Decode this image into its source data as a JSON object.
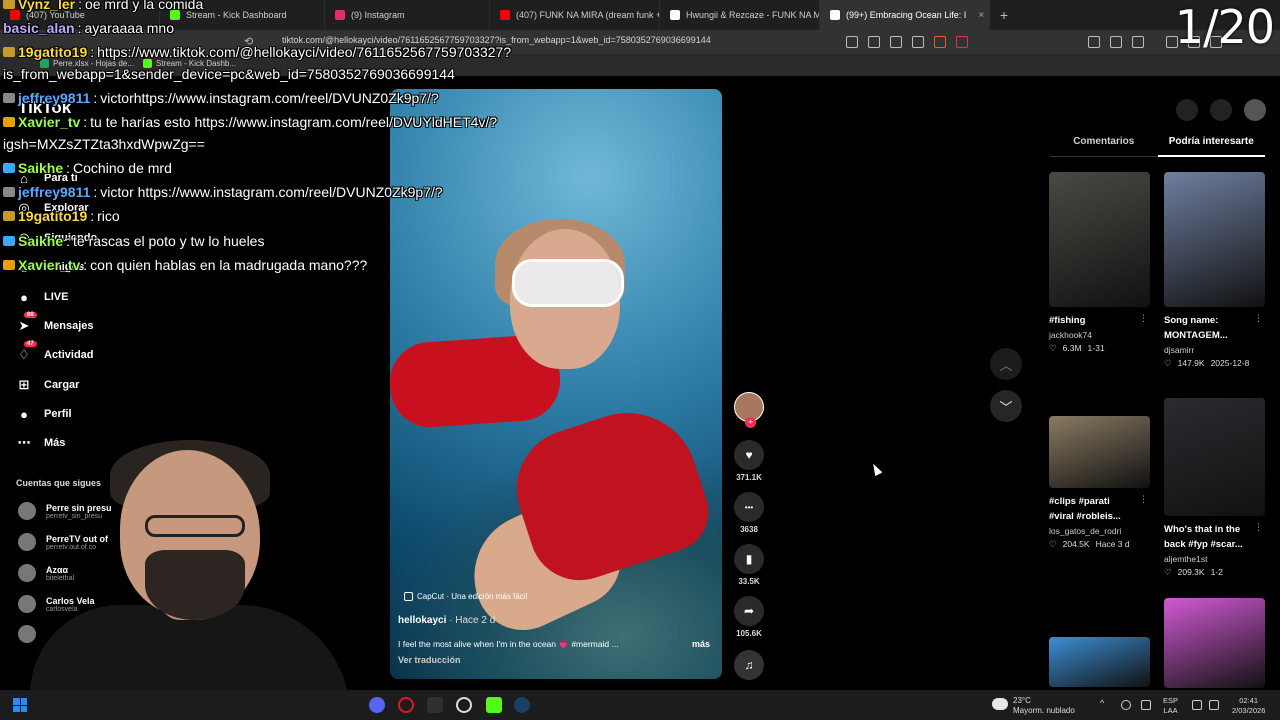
{
  "browser": {
    "tabs": [
      {
        "label": "(407) YouTube",
        "color": "#ff0000"
      },
      {
        "label": "Stream - Kick Dashboard",
        "color": "#53fc18"
      },
      {
        "label": "(9) Instagram",
        "color": "#e1306c"
      },
      {
        "label": "(407) FUNK NA MIRA (dream funk +",
        "color": "#ff0000"
      },
      {
        "label": "Hwungii & Rezcaze - FUNK NA MIRA",
        "color": "#ffffff"
      },
      {
        "label": "(99+) Embracing Ocean Life: I",
        "color": "#ffffff",
        "active": true
      }
    ],
    "new_tab": "+",
    "url": "tiktok.com/@hellokayci/video/7611652567759703327?is_from_webapp=1&web_id=7580352769036699144",
    "bookmarks": [
      {
        "label": "Perre.xlsx - Hojas de...",
        "color": "#1fa463"
      },
      {
        "label": "Stream - Kick Dashb...",
        "color": "#53fc18"
      }
    ]
  },
  "overlay_counter": "1/20",
  "chat": [
    {
      "user": "Vynz_ler",
      "text": " oe mrd y la comida",
      "color": "#ffd84a",
      "badge": "#c79a2b"
    },
    {
      "user": "basic_alan",
      "text": " ayaraaaa mno",
      "color": "#c0a6ff",
      "badge": ""
    },
    {
      "user": "19gatito19",
      "text": " https://www.tiktok.com/@hellokayci/video/7611652567759703327?",
      "color": "#ffd84a",
      "badge": "#c79a2b"
    },
    {
      "user": "",
      "text": "is_from_webapp=1&sender_device=pc&web_id=7580352769036699144",
      "color": "#ffffff",
      "badge": ""
    },
    {
      "user": "jeffrey9811",
      "text": " victorhttps://www.instagram.com/reel/DVUNZ0Zk9p7/?",
      "color": "#5aa9ff",
      "badge": "#888888"
    },
    {
      "user": "Xavier_tv",
      "text": " tu te harías esto https://www.instagram.com/reel/DVUYldHET4v/?",
      "color": "#9dff4a",
      "badge": "#e5a100"
    },
    {
      "user": "",
      "text": "igsh=MXZsZTZta3hxdWpwZg==",
      "color": "#ffffff",
      "badge": ""
    },
    {
      "user": "Saikhe",
      "text": " Cochino de mrd",
      "color": "#9dff4a",
      "badge": "#3aa8ff"
    },
    {
      "user": "jeffrey9811",
      "text": " victor https://www.instagram.com/reel/DVUNZ0Zk9p7/?",
      "color": "#5aa9ff",
      "badge": "#888888"
    },
    {
      "user": "19gatito19",
      "text": " rico",
      "color": "#ffd84a",
      "badge": "#c79a2b"
    },
    {
      "user": "Saikhe",
      "text": " te rascas el poto y tw lo hueles",
      "color": "#9dff4a",
      "badge": "#3aa8ff"
    },
    {
      "user": "Xavier_tv",
      "text": " con quien hablas en la madrugada mano???",
      "color": "#9dff4a",
      "badge": "#e5a100"
    }
  ],
  "tiktok": {
    "logo": "TikTok",
    "nav": [
      {
        "label": "Para ti",
        "icon": "home-icon"
      },
      {
        "label": "Explorar",
        "icon": "compass-icon"
      },
      {
        "label": "Siguiendo",
        "icon": "following-icon"
      },
      {
        "label": "Amigos",
        "icon": "friends-icon"
      },
      {
        "label": "LIVE",
        "icon": "live-icon"
      },
      {
        "label": "Mensajes",
        "icon": "messages-icon",
        "badge": "88"
      },
      {
        "label": "Actividad",
        "icon": "activity-icon",
        "badge": "47"
      },
      {
        "label": "Cargar",
        "icon": "upload-icon"
      },
      {
        "label": "Perfil",
        "icon": "profile-icon"
      },
      {
        "label": "Más",
        "icon": "more-icon"
      }
    ],
    "following_title": "Cuentas que sigues",
    "following": [
      {
        "name": "Perre sin presu",
        "handle": "perretv_sin_presu"
      },
      {
        "name": "PerreTV out of",
        "handle": "perretv.out.of.co"
      },
      {
        "name": "Azαα",
        "handle": "bitelethal"
      },
      {
        "name": "Carlos Vela",
        "handle": "carlosvela"
      },
      {
        "name": "",
        "handle": ""
      }
    ],
    "video": {
      "capcut": "CapCut · Una edición más fácil",
      "author": "hellokayci",
      "time": " · Hace 2 d",
      "caption": "I feel the most alive when I'm in the ocean 💗 #mermaid ...",
      "more": "más",
      "translate": "Ver traducción"
    },
    "actions": [
      {
        "icon": "heart-icon",
        "count": "371.1K",
        "glyph": "♥"
      },
      {
        "icon": "comment-icon",
        "count": "3638",
        "glyph": "•••"
      },
      {
        "icon": "bookmark-icon",
        "count": "33.5K",
        "glyph": "▮"
      },
      {
        "icon": "share-icon",
        "count": "105.6K",
        "glyph": "➦"
      }
    ],
    "right_tabs": [
      "Comentarios",
      "Podría interesarte"
    ],
    "cards": [
      {
        "title": "#fishing",
        "title2": "",
        "user": "jackhook74",
        "likes": "6.3M",
        "date": "1-31",
        "color": "#4a4a44"
      },
      {
        "title": "Song name:",
        "title2": "MONTAGEM...",
        "user": "djsamirr",
        "likes": "147.9K",
        "date": "2025-12-8",
        "color": "#6f7fa0"
      },
      {
        "title": "#clips #parati",
        "title2": "#viral #robleis...",
        "user": "los_gatos_de_rodri",
        "likes": "204.5K",
        "date": "Hace 3 d",
        "color": "#8a7b63"
      },
      {
        "title": "Who's that in the",
        "title2": "back #fyp #scar...",
        "user": "aljemthe1st",
        "likes": "209.3K",
        "date": "1-2",
        "color": "#2d2a30"
      },
      {
        "title": "",
        "title2": "",
        "user": "",
        "likes": "",
        "date": "",
        "color": "#3c8fd6"
      },
      {
        "title": "",
        "title2": "",
        "user": "",
        "likes": "",
        "date": "",
        "color": "#d25ad4"
      }
    ]
  },
  "taskbar": {
    "weather_temp": "23°C",
    "weather_desc": "Mayorm. nublado",
    "lang1": "ESP",
    "lang2": "LAA",
    "time": "02:41",
    "date": "2/03/2026"
  }
}
